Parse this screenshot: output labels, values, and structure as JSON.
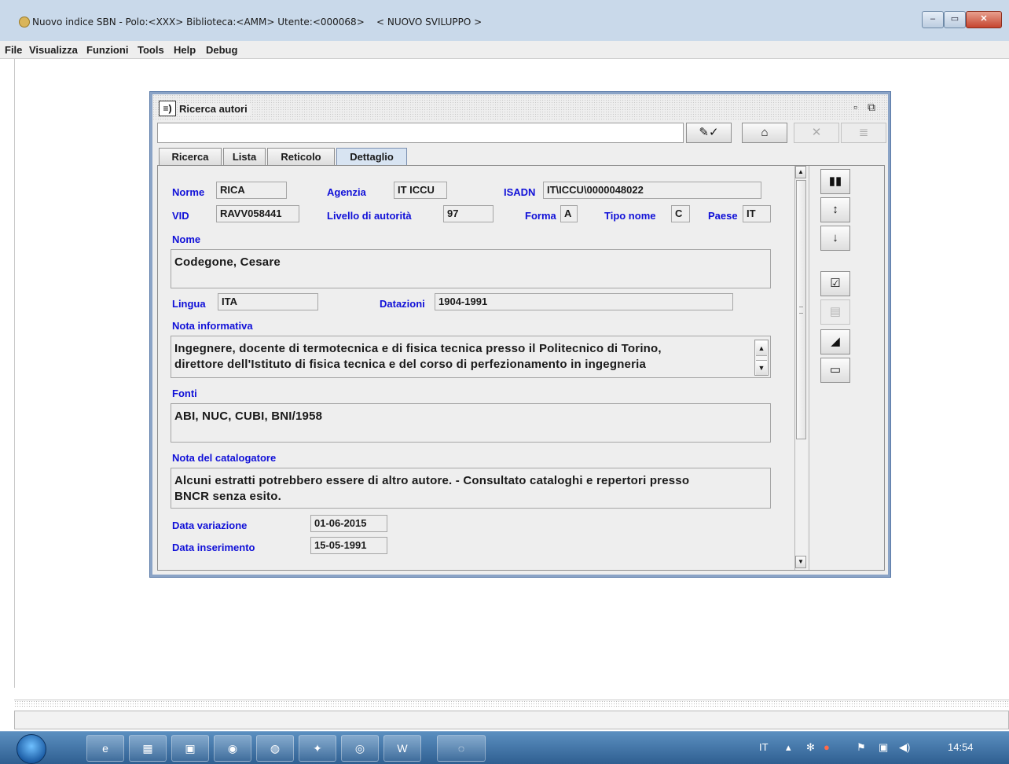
{
  "window": {
    "title": "Nuovo indice SBN - Polo:<XXX> Biblioteca:<AMM> Utente:<000068>    < NUOVO SVILUPPO >",
    "minimize": "–",
    "maximize": "▭",
    "close": "✕"
  },
  "menu": [
    "File",
    "Visualizza",
    "Funzioni",
    "Tools",
    "Help",
    "Debug"
  ],
  "frame": {
    "title": "Ricerca autori",
    "icon_text": "≡)",
    "ctrl_restore": "▫",
    "ctrl_max": "⧉"
  },
  "toolbar": {
    "command_value": "",
    "btn_confirm": "✎✓",
    "btn_home": "⌂",
    "btn_cancel": "✕",
    "btn_list": "≣"
  },
  "tabs": [
    "Ricerca",
    "Lista",
    "Reticolo",
    "Dettaglio"
  ],
  "active_tab": "Dettaglio",
  "detail": {
    "norme_label": "Norme",
    "norme": "RICA",
    "agenzia_label": "Agenzia",
    "agenzia": "IT ICCU",
    "isadn_label": "ISADN",
    "isadn": "IT\\ICCU\\0000048022",
    "vid_label": "VID",
    "vid": "RAVV058441",
    "livello_label": "Livello di autorità",
    "livello": "97",
    "forma_label": "Forma",
    "forma": "A",
    "tipo_label": "Tipo nome",
    "tipo": "C",
    "paese_label": "Paese",
    "paese": "IT",
    "nome_label": "Nome",
    "nome": "Codegone, Cesare",
    "lingua_label": "Lingua",
    "lingua": "ITA",
    "datazioni_label": "Datazioni",
    "datazioni": "1904-1991",
    "nota_label": "Nota informativa",
    "nota_line1": "Ingegnere, docente di termotecnica e di fisica tecnica presso il Politecnico di Torino,",
    "nota_line2": "direttore dell'Istituto di fisica tecnica e del corso di perfezionamento in ingegneria",
    "fonti_label": "Fonti",
    "fonti": "ABI, NUC, CUBI, BNI/1958",
    "notacat_label": "Nota del catalogatore",
    "notacat_line1": "Alcuni estratti potrebbero essere di altro autore. - Consultato cataloghi e repertori presso",
    "notacat_line2": "BNCR senza esito.",
    "datavar_label": "Data variazione",
    "datavar": "01-06-2015",
    "datains_label": "Data inserimento",
    "datains": "15-05-1991"
  },
  "sidebar_icons": [
    "books-icon",
    "arrow-up-doc-icon",
    "arrow-down-doc-icon",
    "check-doc-icon",
    "disabled-doc-icon",
    "eraser-icon",
    "printer-icon"
  ],
  "sidebar_glyphs": [
    "▮▮",
    "↕",
    "↓",
    "☑",
    "▤",
    "◢",
    "▭"
  ],
  "statusbar_text": "",
  "taskbar": {
    "apps": [
      "e",
      "▦",
      "▣",
      "◉",
      "◍",
      "✦",
      "◎",
      "W",
      "◌"
    ],
    "lang": "IT",
    "clock": "14:54"
  }
}
